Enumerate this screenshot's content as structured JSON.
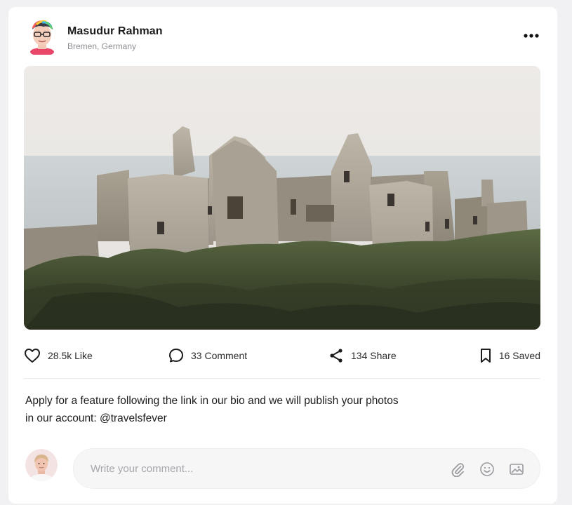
{
  "post": {
    "author": {
      "name": "Masudur Rahman",
      "location": "Bremen, Germany",
      "avatar_icon": "memoji-avatar"
    },
    "menu_icon": "more-horizontal-icon",
    "photo_subject": "castle-ruins-photo",
    "actions": {
      "like": {
        "label": "28.5k Like",
        "icon": "heart-icon"
      },
      "comment": {
        "label": "33 Comment",
        "icon": "chat-bubble-icon"
      },
      "share": {
        "label": "134 Share",
        "icon": "share-icon"
      },
      "saved": {
        "label": "16 Saved",
        "icon": "bookmark-icon"
      }
    },
    "caption_line1": "Apply for a feature following the link in our bio and we will publish your photos",
    "caption_line2": "in our account: @travelsfever"
  },
  "comment_box": {
    "placeholder": "Write your comment...",
    "value": "",
    "tools": [
      "paperclip-icon",
      "smiley-icon",
      "image-icon"
    ]
  },
  "colors": {
    "page_bg": "#f1f1f3",
    "card_bg": "#ffffff",
    "text_primary": "#1c1c1e",
    "text_secondary": "#8e8e93",
    "input_bg": "#f6f6f7"
  }
}
